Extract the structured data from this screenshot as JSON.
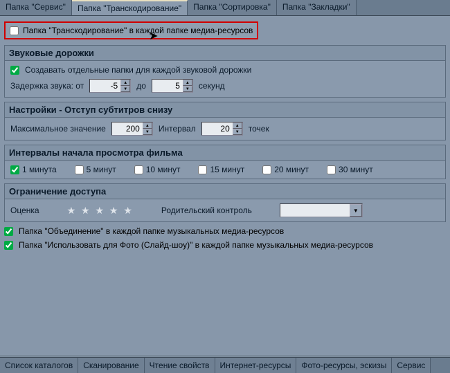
{
  "tabs_top": [
    "Папка \"Сервис\"",
    "Папка \"Транскодирование\"",
    "Папка \"Сортировка\"",
    "Папка \"Закладки\""
  ],
  "tabs_top_active": 1,
  "redbox_label": "Папка \"Транскодирование\" в каждой папке  медиа-ресурсов",
  "sound": {
    "title": "Звуковые дорожки",
    "create_label": "Создавать отдельные папки для каждой звуковой дорожки",
    "delay_from_label": "Задержка звука: от",
    "delay_from_value": "-5",
    "to_label": "до",
    "delay_to_value": "5",
    "seconds_label": "секунд"
  },
  "subs": {
    "title": "Настройки - Отступ субтитров снизу",
    "max_label": "Максимальное значение",
    "max_value": "200",
    "interval_label": "Интервал",
    "interval_value": "20",
    "points_label": "точек"
  },
  "intervals": {
    "title": "Интервалы начала просмотра фильма",
    "items": [
      "1 минута",
      "5 минут",
      "10 минут",
      "15 минут",
      "20 минут",
      "30 минут"
    ],
    "checked": [
      true,
      false,
      false,
      false,
      false,
      false
    ]
  },
  "access": {
    "title": "Ограничение доступа",
    "rating_label": "Оценка",
    "parental_label": "Родительский контроль",
    "parental_value": ""
  },
  "folder_union_label": "Папка \"Объединение\" в каждой папке музыкальных медиа-ресурсов",
  "folder_photo_label": "Папка \"Использовать для Фото (Слайд-шоу)\" в каждой папке музыкальных медиа-ресурсов",
  "tabs_bottom": [
    "Список каталогов",
    "Сканирование",
    "Чтение свойств",
    "Интернет-ресурсы",
    "Фото-ресурсы, эскизы",
    "Сервис"
  ]
}
